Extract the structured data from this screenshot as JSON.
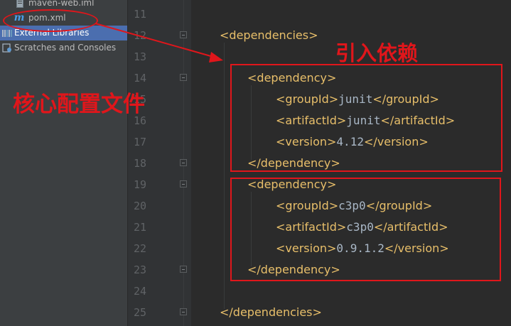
{
  "project_tree": {
    "items": [
      {
        "label": "maven-web.iml",
        "icon": "iml-file-icon"
      },
      {
        "label": "pom.xml",
        "icon": "maven-m-icon"
      },
      {
        "label": "External Libraries",
        "icon": "libraries-icon"
      },
      {
        "label": "Scratches and Consoles",
        "icon": "scratches-icon"
      }
    ],
    "pom_icon_glyph": "m"
  },
  "gutter": {
    "line_numbers": [
      "11",
      "12",
      "13",
      "14",
      "15",
      "16",
      "17",
      "18",
      "19",
      "20",
      "21",
      "22",
      "23",
      "24",
      "25"
    ]
  },
  "code": {
    "lines": [
      {
        "n": "12",
        "open": "<dependencies>",
        "text": "",
        "close": ""
      },
      {
        "n": "14",
        "open": "<dependency>",
        "text": "",
        "close": ""
      },
      {
        "n": "15",
        "open": "<groupId>",
        "text": "junit",
        "close": "</groupId>"
      },
      {
        "n": "16",
        "open": "<artifactId>",
        "text": "junit",
        "close": "</artifactId>"
      },
      {
        "n": "17",
        "open": "<version>",
        "text": "4.12",
        "close": "</version>"
      },
      {
        "n": "18",
        "open": "</dependency>",
        "text": "",
        "close": ""
      },
      {
        "n": "19",
        "open": "<dependency>",
        "text": "",
        "close": ""
      },
      {
        "n": "20",
        "open": "<groupId>",
        "text": "c3p0",
        "close": "</groupId>"
      },
      {
        "n": "21",
        "open": "<artifactId>",
        "text": "c3p0",
        "close": "</artifactId>"
      },
      {
        "n": "22",
        "open": "<version>",
        "text": "0.9.1.2",
        "close": "</version>"
      },
      {
        "n": "23",
        "open": "</dependency>",
        "text": "",
        "close": ""
      },
      {
        "n": "25",
        "open": "</dependencies>",
        "text": "",
        "close": ""
      }
    ]
  },
  "annotations": {
    "core_config_label": "核心配置文件",
    "import_deps_label": "引入依赖",
    "color": "#e0161b"
  },
  "colors": {
    "tag": "#e8bf6a",
    "text": "#a9b7c6",
    "selection": "#4b6eaf"
  }
}
